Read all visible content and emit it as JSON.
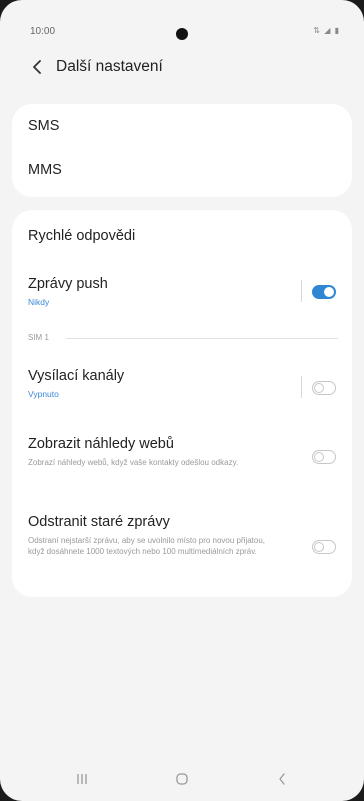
{
  "status_bar": {
    "time": "10:00",
    "icons": "⇅ ◢ ▮"
  },
  "header": {
    "title": "Další nastavení",
    "back_icon": "chevron-left-icon"
  },
  "group1": {
    "items": [
      {
        "label": "SMS"
      },
      {
        "label": "MMS"
      }
    ]
  },
  "group2": {
    "quick_replies": {
      "label": "Rychlé odpovědi"
    },
    "push": {
      "label": "Zprávy push",
      "sub": "Nikdy",
      "enabled": true
    },
    "section_label": "SIM 1",
    "broadcast": {
      "label": "Vysílací kanály",
      "sub": "Vypnuto",
      "enabled": false
    },
    "web_previews": {
      "label": "Zobrazit náhledy webů",
      "desc": "Zobrazí náhledy webů, když vaše kontakty odešlou odkazy.",
      "enabled": false
    },
    "delete_old": {
      "label": "Odstranit staré zprávy",
      "desc": "Odstraní nejstarší zprávu, aby se uvolnilo místo pro novou přijatou, když dosáhnete 1000 textových nebo 100 multimediálních zpráv.",
      "enabled": false
    }
  },
  "colors": {
    "accent": "#2f87d3",
    "sub_blue": "#3a8ad8",
    "background": "#f4f4f4",
    "card": "#ffffff"
  },
  "nav": {
    "recent_icon": "recent-apps-icon",
    "home_icon": "home-icon",
    "back_icon": "back-icon"
  }
}
